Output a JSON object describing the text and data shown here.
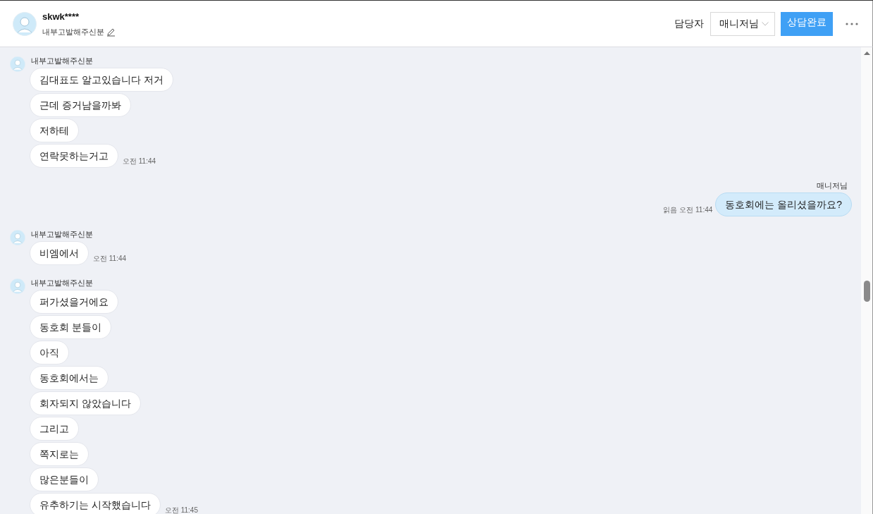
{
  "header": {
    "name": "skwk****",
    "subtitle": "내부고발해주신분",
    "assignee_label": "담당자",
    "assignee": "매니저님",
    "complete_button": "상담완료"
  },
  "messages": [
    {
      "kind": "incoming",
      "sender": "내부고발해주신분",
      "time": "오전 11:44",
      "texts": [
        "김대표도 알고있습니다 저거",
        "근데 증거남을까봐",
        "저하테",
        "연락못하는거고"
      ]
    },
    {
      "kind": "outgoing",
      "sender": "매니저님",
      "read": "읽음",
      "time": "오전 11:44",
      "texts": [
        "동호회에는 올리셨을까요?"
      ]
    },
    {
      "kind": "incoming",
      "sender": "내부고발해주신분",
      "time": "오전 11:44",
      "texts": [
        "비엠에서"
      ]
    },
    {
      "kind": "incoming",
      "sender": "내부고발해주신분",
      "time": "오전 11:45",
      "texts": [
        "퍼가셨을거에요",
        "동호회 분들이",
        "아직",
        "동호회에서는",
        "회자되지 않았습니다",
        "그리고",
        "쪽지로는",
        "많은분들이",
        "유추하기는 시작했습니다"
      ]
    }
  ]
}
